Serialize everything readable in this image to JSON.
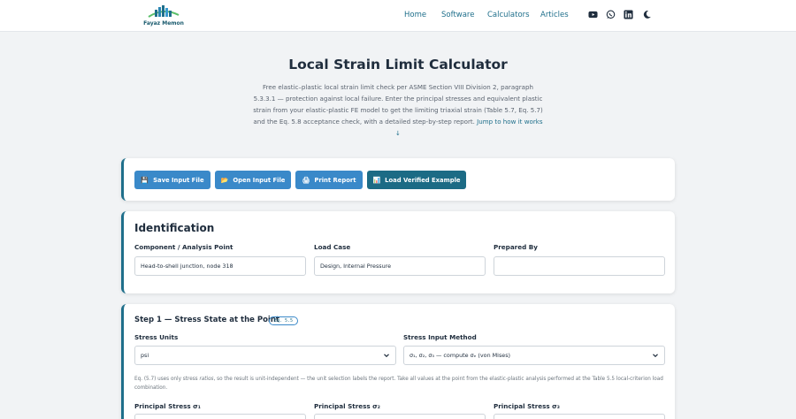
{
  "brand": {
    "name": "Fayaz Memon"
  },
  "nav": {
    "links": [
      "Home",
      "Software",
      "Calculators",
      "Articles"
    ],
    "icons": [
      "youtube-icon",
      "whatsapp-icon",
      "linkedin-icon",
      "moon-icon"
    ]
  },
  "hero": {
    "title": "Local Strain Limit Calculator",
    "description": "Free elastic–plastic local strain limit check per ASME Section VIII Division 2, paragraph 5.3.3.1 — protection against local failure. Enter the principal stresses and equivalent plastic strain from your elastic-plastic FE model to get the limiting triaxial strain (Table 5.7, Eq. 5.7) and the Eq. 5.8 acceptance check, with a detailed step-by-step report.",
    "link": "Jump to how it works ↓"
  },
  "actions": {
    "save": "Save Input File",
    "open": "Open Input File",
    "print": "Print Report",
    "example": "Load Verified Example"
  },
  "identification": {
    "title": "Identification",
    "component_label": "Component / Analysis Point",
    "component_value": "Head-to-shell junction, node 318",
    "load_label": "Load Case",
    "load_value": "Design, Internal Pressure",
    "prepared_label": "Prepared By",
    "prepared_value": ""
  },
  "step1": {
    "title": "Step 1 — Stress State at the Point",
    "badge": "Eq. 5.5",
    "units_label": "Stress Units",
    "units_value": "psi",
    "method_label": "Stress Input Method",
    "method_value": "σ₁, σ₂, σ₃ — compute σₑ (von Mises)",
    "note_pre": "Eq. (5.7) uses only stress ",
    "note_em": "ratios",
    "note_post": ", so the result is unit-independent — the unit selection labels the report. Take all values at the point from the elastic-plastic analysis performed at the Table 5.5 local-criterion load combination.",
    "p1_label": "Principal Stress σ₁",
    "p2_label": "Principal Stress σ₂",
    "p3_label": "Principal Stress σ₃"
  },
  "colors": {
    "primary": "#1f6f8b",
    "button": "#3a89c9",
    "button_dark": "#1c6b85"
  }
}
